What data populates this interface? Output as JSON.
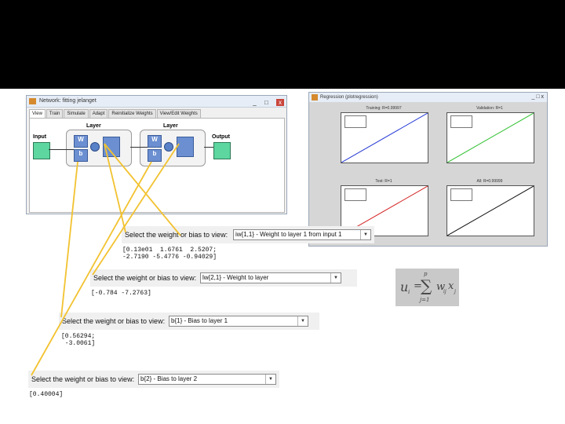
{
  "network_window": {
    "title": "Network: fitting jelanget",
    "tabs": [
      "View",
      "Train",
      "Simulate",
      "Adapt",
      "Reinitialize Weights",
      "View/Edit Weights"
    ],
    "input_label": "Input",
    "output_label": "Output",
    "layer_label": "Layer",
    "w_label": "W",
    "b_label": "b",
    "close_label": "x"
  },
  "plot_window": {
    "title": "Regression (plotregression)",
    "subplots": [
      {
        "title": "Training: R=0.99997",
        "line_color": "#2b3fd6"
      },
      {
        "title": "Validation: R=1",
        "line_color": "#2fc02f"
      },
      {
        "title": "Test: R=1",
        "line_color": "#d62b2b"
      },
      {
        "title": "All: R=0.99999",
        "line_color": "#111111"
      }
    ]
  },
  "panels": [
    {
      "prompt": "Select the weight or bias to view:",
      "selected": "iw{1,1} - Weight to layer 1 from input 1",
      "values": "[0.13e01  1.6761  2.5207;\n-2.7190 -5.4776 -0.94029]"
    },
    {
      "prompt": "Select the weight or bias to view:",
      "selected": "lw{2,1} - Weight to layer",
      "values": "[-0.784 -7.2763]"
    },
    {
      "prompt": "Select the weight or bias to view:",
      "selected": "b{1} - Bias to layer 1",
      "values": "[0.56294;\n -3.0061]"
    },
    {
      "prompt": "Select the weight or bias to view:",
      "selected": "b{2} - Bias to layer 2",
      "values": "[0.40004]"
    }
  ],
  "formula": {
    "lhs": "u",
    "lhs_sub": "i",
    "eq": "=",
    "sum": "∑",
    "upper": "p",
    "lower": "j=1",
    "term": "w",
    "term_sub": "ij",
    "var": "x",
    "var_sub": "j"
  }
}
